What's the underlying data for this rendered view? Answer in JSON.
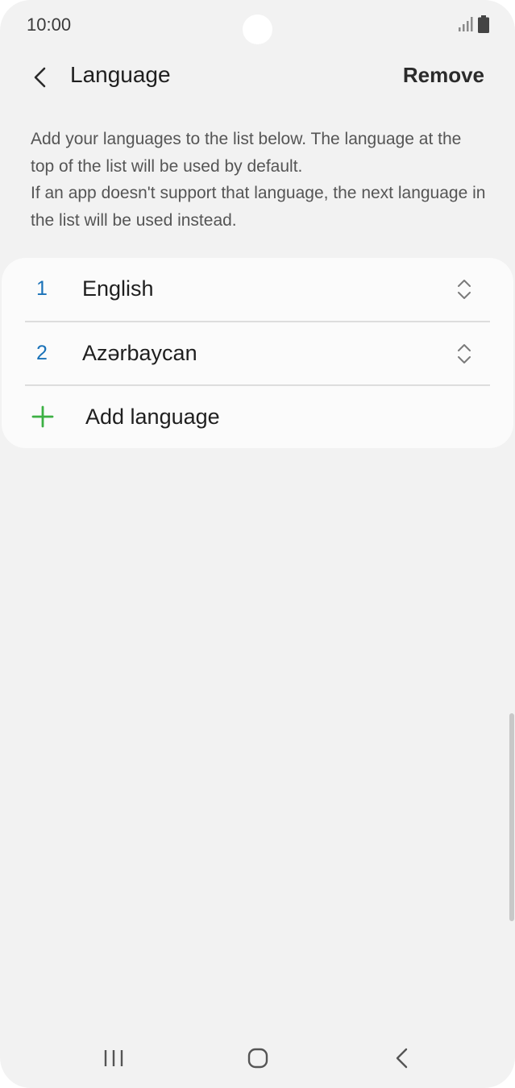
{
  "status_bar": {
    "time": "10:00",
    "icons": [
      "signal-icon",
      "battery-icon"
    ]
  },
  "header": {
    "back_icon": "chevron-left-icon",
    "title": "Language",
    "action_label": "Remove"
  },
  "description": {
    "line1": "Add your languages to the list below. The language at the top of the list will be used by default.",
    "line2": "If an app doesn't support that language, the next language in the list will be used instead."
  },
  "languages": [
    {
      "number": "1",
      "name": "English",
      "handle_icon": "reorder-icon"
    },
    {
      "number": "2",
      "name": "Azərbaycan",
      "handle_icon": "reorder-icon"
    }
  ],
  "add_language": {
    "icon": "plus-icon",
    "label": "Add language"
  },
  "nav_bar": {
    "icons": [
      "recents-icon",
      "home-icon",
      "back-icon"
    ]
  },
  "colors": {
    "background": "#f2f2f2",
    "card": "#fbfbfb",
    "number_accent": "#1a72b8",
    "plus_accent": "#3cb043"
  }
}
